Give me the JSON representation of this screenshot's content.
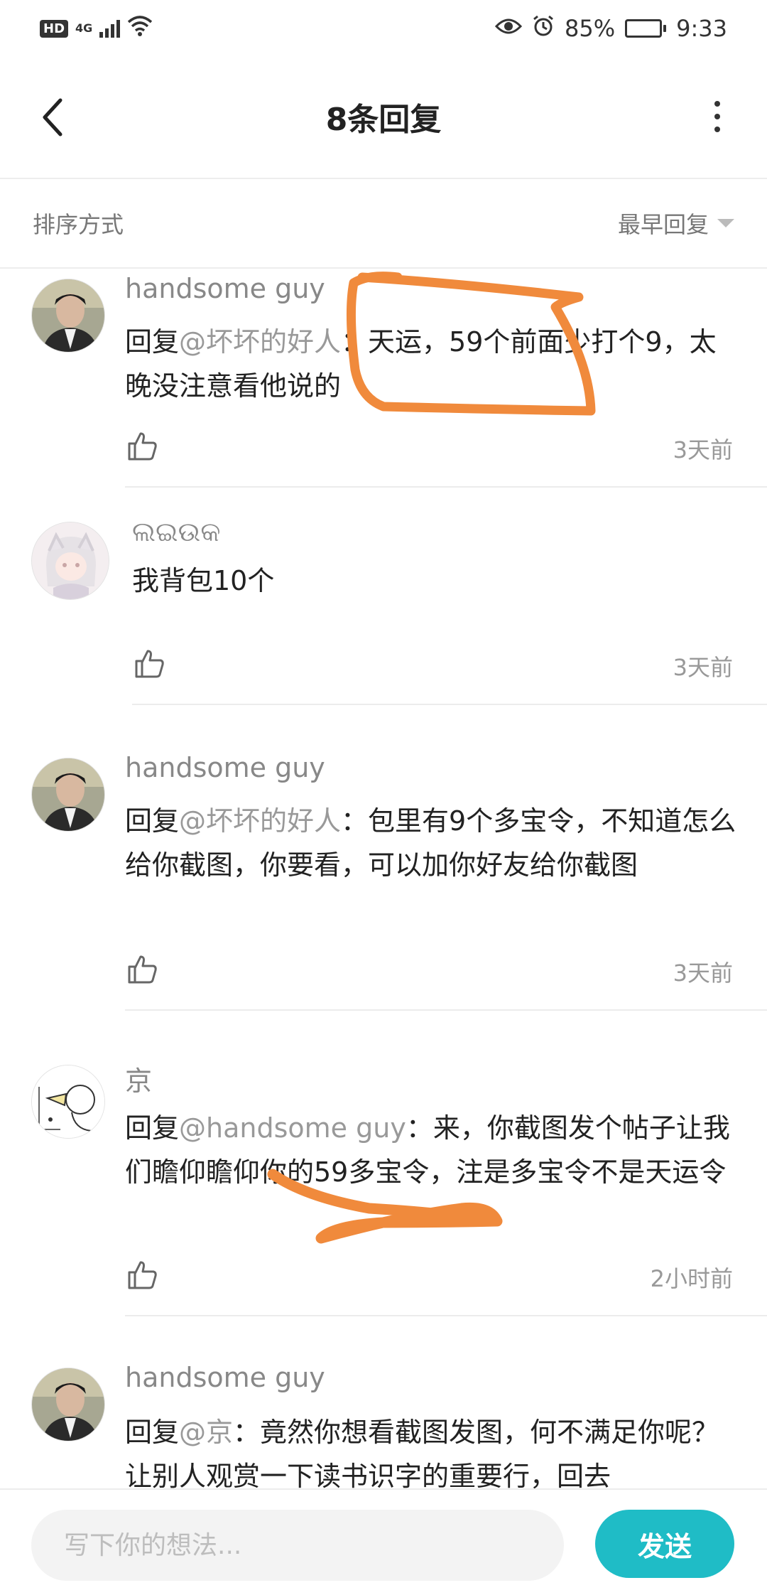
{
  "status_bar": {
    "left_badge": "HD",
    "network": "4G",
    "battery_percent": "85%",
    "battery_level": 0.85,
    "time": "9:33",
    "icons": [
      "hd-icon",
      "signal-icon",
      "wifi-icon",
      "eye-icon",
      "alarm-icon",
      "battery-icon"
    ]
  },
  "header": {
    "title": "8条回复",
    "back_icon": "back-arrow-icon",
    "more_icon": "more-vertical-icon"
  },
  "sort": {
    "label": "排序方式",
    "value": "最早回复"
  },
  "replies": [
    {
      "user": "handsome guy",
      "reply_prefix": "回复",
      "mention": "@坏坏的好人",
      "text": "：天运，59个前面少打个9，太晚没注意看他说的",
      "time": "3天前",
      "avatar": "person-photo"
    },
    {
      "user": "ଲଇଉକ",
      "reply_prefix": "",
      "mention": "",
      "text": "我背包10个",
      "time": "3天前",
      "avatar": "anime-girl"
    },
    {
      "user": "handsome guy",
      "reply_prefix": "回复",
      "mention": "@坏坏的好人",
      "text": "：包里有9个多宝令，不知道怎么给你截图，你要看，可以加你好友给你截图",
      "time": "3天前",
      "avatar": "person-photo"
    },
    {
      "user": "京",
      "reply_prefix": "回复",
      "mention": "@handsome guy",
      "text": "：来，你截图发个帖子让我们瞻仰瞻仰你的59多宝令，注是多宝令不是天运令",
      "time": "2小时前",
      "avatar": "doodle-drawing"
    },
    {
      "user": "handsome guy",
      "reply_prefix": "回复",
      "mention": "@京",
      "text": "：竟然你想看截图发图，何不满足你呢？让别人观赏一下读书识字的重要行，回去",
      "time": "",
      "avatar": "person-photo"
    }
  ],
  "composer": {
    "placeholder": "写下你的想法...",
    "send_label": "发送"
  },
  "colors": {
    "accent": "#1fbcc6",
    "scribble": "#f08a3c",
    "mention": "#999999"
  }
}
